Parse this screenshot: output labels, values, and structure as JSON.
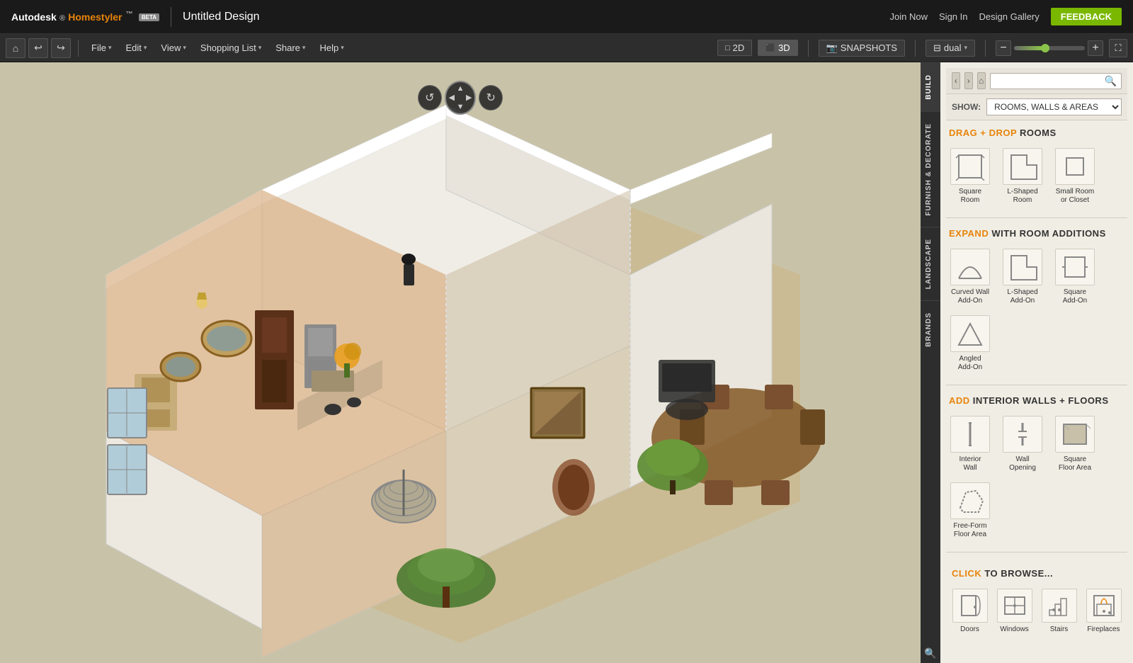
{
  "app": {
    "name": "Autodesk",
    "product": "Homestyler",
    "beta_label": "BETA",
    "title": "Untitled Design",
    "top_links": [
      "Join Now",
      "Sign In",
      "Design Gallery"
    ],
    "feedback_label": "FEEDBACK"
  },
  "toolbar": {
    "menus": [
      "File",
      "Edit",
      "View",
      "Shopping List",
      "Share",
      "Help"
    ],
    "view_2d": "2D",
    "view_3d": "3D",
    "snapshots": "SNAPSHOTS",
    "dual": "dual"
  },
  "panel": {
    "show_label": "SHOW:",
    "show_options": [
      "ROOMS, WALLS & AREAS"
    ],
    "back_btn": "‹",
    "forward_btn": "›",
    "home_btn": "⌂",
    "search_placeholder": "",
    "tabs": [
      {
        "id": "build",
        "label": "BUILD",
        "active": true
      },
      {
        "id": "furnish",
        "label": "FURNISH & DECORATE"
      },
      {
        "id": "landscape",
        "label": "LANDSCAPE"
      },
      {
        "id": "brands",
        "label": "BRANDS"
      }
    ],
    "sections": [
      {
        "id": "drag-drop-rooms",
        "header_parts": [
          {
            "text": "DRAG + DROP",
            "highlight": true
          },
          {
            "text": " ROOMS",
            "highlight": false
          }
        ],
        "items": [
          {
            "id": "square-room",
            "label": "Square\nRoom",
            "shape": "square"
          },
          {
            "id": "l-shaped-room",
            "label": "L-Shaped\nRoom",
            "shape": "l-shape"
          },
          {
            "id": "small-room",
            "label": "Small Room\nor Closet",
            "shape": "small-square"
          }
        ]
      },
      {
        "id": "expand-rooms",
        "header_parts": [
          {
            "text": "EXPAND",
            "highlight": true
          },
          {
            "text": " WITH ROOM ADDITIONS",
            "highlight": false
          }
        ],
        "items": [
          {
            "id": "curved-wall",
            "label": "Curved Wall\nAdd-On",
            "shape": "arch"
          },
          {
            "id": "l-shaped-addon",
            "label": "L-Shaped\nAdd-On",
            "shape": "l-addon"
          },
          {
            "id": "square-addon",
            "label": "Square\nAdd-On",
            "shape": "square-addon"
          },
          {
            "id": "angled-addon",
            "label": "Angled\nAdd-On",
            "shape": "angled"
          }
        ]
      },
      {
        "id": "interior-walls",
        "header_parts": [
          {
            "text": "ADD",
            "highlight": true
          },
          {
            "text": " INTERIOR WALLS + FLOORS",
            "highlight": false
          }
        ],
        "items": [
          {
            "id": "interior-wall",
            "label": "Interior\nWall",
            "shape": "wall-line"
          },
          {
            "id": "wall-opening",
            "label": "Wall\nOpening",
            "shape": "wall-opening"
          },
          {
            "id": "square-floor",
            "label": "Square\nFloor Area",
            "shape": "floor-square"
          },
          {
            "id": "freeform-floor",
            "label": "Free-Form\nFloor Area",
            "shape": "floor-freeform"
          }
        ]
      }
    ],
    "browse_section": {
      "header_parts": [
        {
          "text": "CLICK",
          "highlight": true
        },
        {
          "text": " TO BROWSE...",
          "highlight": false
        }
      ],
      "items": [
        {
          "id": "doors",
          "label": "Doors",
          "shape": "door"
        },
        {
          "id": "windows",
          "label": "Windows",
          "shape": "window"
        },
        {
          "id": "stairs",
          "label": "Stairs",
          "shape": "stairs"
        },
        {
          "id": "fireplaces",
          "label": "Fireplaces",
          "shape": "fireplace"
        }
      ]
    }
  }
}
